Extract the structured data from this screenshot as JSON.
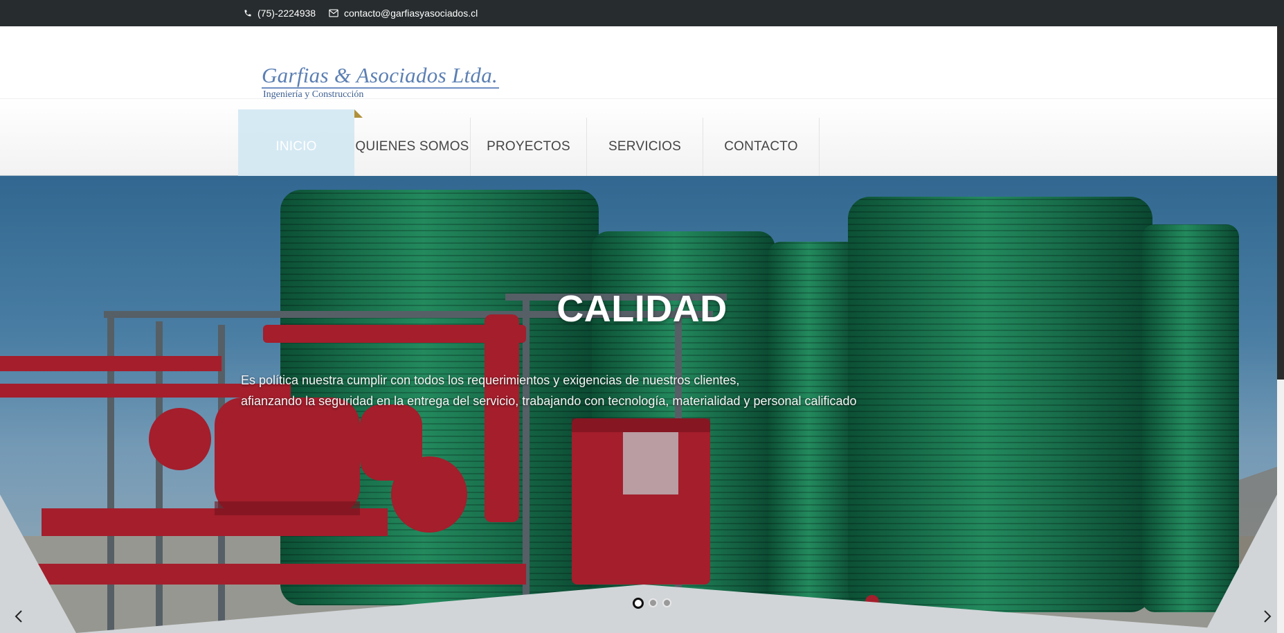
{
  "topbar": {
    "phone": "(75)-2224938",
    "email": "contacto@garfiasyasociados.cl",
    "phone_icon": "phone-icon",
    "email_icon": "envelope-icon"
  },
  "logo": {
    "name": "Garfias & Asociados Ltda.",
    "tagline": "Ingeniería y Construcción"
  },
  "nav": {
    "items": [
      {
        "label": "INICIO",
        "active": true
      },
      {
        "label": "QUIENES SOMOS",
        "active": false
      },
      {
        "label": "PROYECTOS",
        "active": false
      },
      {
        "label": "SERVICIOS",
        "active": false
      },
      {
        "label": "CONTACTO",
        "active": false
      }
    ]
  },
  "slider": {
    "title": "CALIDAD",
    "text_line1": "Es política nuestra cumplir con todos los requerimientos y exigencias de nuestros clientes,",
    "text_line2": "afianzando la seguridad en la entrega del servicio, trabajando con tecnología, materialidad y personal calificado",
    "current_slide": 1,
    "total_slides": 3,
    "prev_icon": "chevron-left-icon",
    "next_icon": "chevron-right-icon"
  },
  "colors": {
    "topbar_bg": "#272c2e",
    "active_nav_bg": "#cfe6f2",
    "logo_blue": "#5b7fb3",
    "tank_green": "#1f8a55",
    "pipe_red": "#c8202e"
  }
}
